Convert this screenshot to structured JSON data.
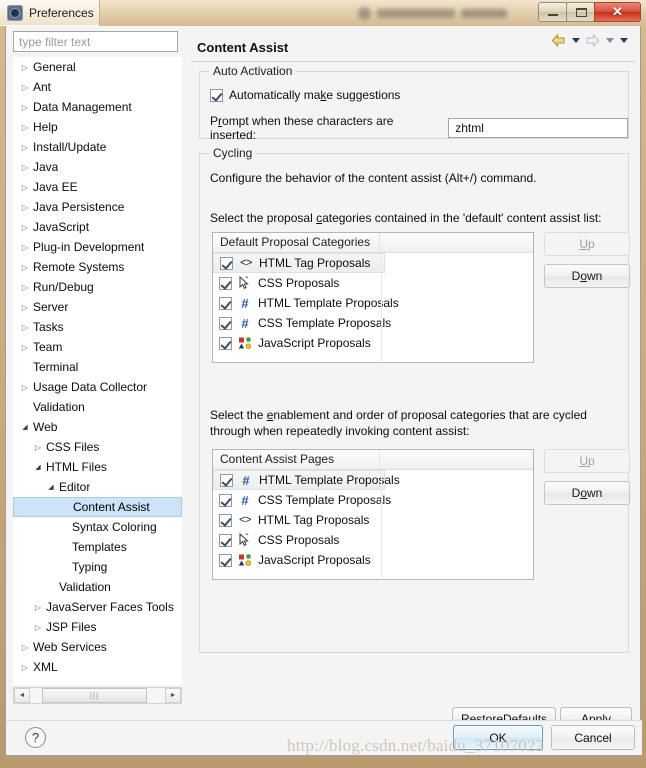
{
  "window": {
    "title": "Preferences",
    "icon": "preferences-gear-icon",
    "minimize_label": "",
    "maximize_label": "",
    "close_label": "✕"
  },
  "sidebar": {
    "filter_placeholder": "type filter text",
    "filter_value": "",
    "items": [
      {
        "label": "General",
        "indent": 0,
        "arrow": "collapsed",
        "selected": false
      },
      {
        "label": "Ant",
        "indent": 0,
        "arrow": "collapsed",
        "selected": false
      },
      {
        "label": "Data Management",
        "indent": 0,
        "arrow": "collapsed",
        "selected": false
      },
      {
        "label": "Help",
        "indent": 0,
        "arrow": "collapsed",
        "selected": false
      },
      {
        "label": "Install/Update",
        "indent": 0,
        "arrow": "collapsed",
        "selected": false
      },
      {
        "label": "Java",
        "indent": 0,
        "arrow": "collapsed",
        "selected": false
      },
      {
        "label": "Java EE",
        "indent": 0,
        "arrow": "collapsed",
        "selected": false
      },
      {
        "label": "Java Persistence",
        "indent": 0,
        "arrow": "collapsed",
        "selected": false
      },
      {
        "label": "JavaScript",
        "indent": 0,
        "arrow": "collapsed",
        "selected": false
      },
      {
        "label": "Plug-in Development",
        "indent": 0,
        "arrow": "collapsed",
        "selected": false
      },
      {
        "label": "Remote Systems",
        "indent": 0,
        "arrow": "collapsed",
        "selected": false
      },
      {
        "label": "Run/Debug",
        "indent": 0,
        "arrow": "collapsed",
        "selected": false
      },
      {
        "label": "Server",
        "indent": 0,
        "arrow": "collapsed",
        "selected": false
      },
      {
        "label": "Tasks",
        "indent": 0,
        "arrow": "collapsed",
        "selected": false
      },
      {
        "label": "Team",
        "indent": 0,
        "arrow": "collapsed",
        "selected": false
      },
      {
        "label": "Terminal",
        "indent": 0,
        "arrow": "none",
        "selected": false
      },
      {
        "label": "Usage Data Collector",
        "indent": 0,
        "arrow": "collapsed",
        "selected": false
      },
      {
        "label": "Validation",
        "indent": 0,
        "arrow": "none",
        "selected": false
      },
      {
        "label": "Web",
        "indent": 0,
        "arrow": "expanded",
        "selected": false
      },
      {
        "label": "CSS Files",
        "indent": 1,
        "arrow": "collapsed",
        "selected": false
      },
      {
        "label": "HTML Files",
        "indent": 1,
        "arrow": "expanded",
        "selected": false
      },
      {
        "label": "Editor",
        "indent": 2,
        "arrow": "expanded",
        "selected": false
      },
      {
        "label": "Content Assist",
        "indent": 3,
        "arrow": "none",
        "selected": true
      },
      {
        "label": "Syntax Coloring",
        "indent": 3,
        "arrow": "none",
        "selected": false
      },
      {
        "label": "Templates",
        "indent": 3,
        "arrow": "none",
        "selected": false
      },
      {
        "label": "Typing",
        "indent": 3,
        "arrow": "none",
        "selected": false
      },
      {
        "label": "Validation",
        "indent": 2,
        "arrow": "none",
        "selected": false
      },
      {
        "label": "JavaServer Faces Tools",
        "indent": 1,
        "arrow": "collapsed",
        "selected": false
      },
      {
        "label": "JSP Files",
        "indent": 1,
        "arrow": "collapsed",
        "selected": false
      },
      {
        "label": "Web Services",
        "indent": 0,
        "arrow": "collapsed",
        "selected": false
      },
      {
        "label": "XML",
        "indent": 0,
        "arrow": "collapsed",
        "selected": false
      }
    ],
    "scrollbar": {
      "left_arrow": "◄",
      "right_arrow": "►",
      "thumb_grip": "|||"
    }
  },
  "page": {
    "title": "Content Assist",
    "nav": {
      "back_icon": "back-arrow-icon",
      "back_caret": "▼",
      "forward_icon": "forward-arrow-icon",
      "forward_caret": "▼",
      "menu_caret": "▼"
    }
  },
  "auto_activation": {
    "group_label": "Auto Activation",
    "checkbox_label_pre": "Automatically ma",
    "checkbox_label_mn": "k",
    "checkbox_label_post": "e suggestions",
    "checkbox_checked": true,
    "prompt_label_pre": "P",
    "prompt_label_mn": "r",
    "prompt_label_post": "ompt when these characters are inserted:",
    "prompt_value": "zhtml"
  },
  "cycling": {
    "group_label": "Cycling",
    "description": "Configure the behavior of the content assist (Alt+/) command.",
    "question1_pre": "Select the proposal ",
    "question1_mn": "c",
    "question1_post": "ategories contained in the 'default' content assist list:",
    "question2_pre": "Select the ",
    "question2_mn": "e",
    "question2_post": "nablement and order of proposal categories that are cycled through when repeatedly invoking content assist:",
    "table1": {
      "column1_header": "Default Proposal Categories",
      "column2_header": "",
      "rows": [
        {
          "checked": true,
          "icon": "html-tag-icon",
          "label": "HTML Tag Proposals",
          "selected": true
        },
        {
          "checked": true,
          "icon": "css-cursor-icon",
          "label": "CSS Proposals",
          "selected": false
        },
        {
          "checked": true,
          "icon": "template-hash-icon",
          "label": "HTML Template Proposals",
          "selected": false
        },
        {
          "checked": true,
          "icon": "template-hash-icon",
          "label": "CSS Template Proposals",
          "selected": false
        },
        {
          "checked": true,
          "icon": "javascript-shapes-icon",
          "label": "JavaScript Proposals",
          "selected": false
        }
      ],
      "up_label": "Up",
      "up_mn": "U",
      "up_enabled": false,
      "down_label": "Down",
      "down_mn": "o",
      "down_enabled": true
    },
    "table2": {
      "column1_header": "Content Assist Pages",
      "column2_header": "",
      "rows": [
        {
          "checked": true,
          "icon": "template-hash-icon",
          "label": "HTML Template Proposals",
          "selected": true
        },
        {
          "checked": true,
          "icon": "template-hash-icon",
          "label": "CSS Template Proposals",
          "selected": false
        },
        {
          "checked": true,
          "icon": "html-tag-icon",
          "label": "HTML Tag Proposals",
          "selected": false
        },
        {
          "checked": true,
          "icon": "css-cursor-icon",
          "label": "CSS Proposals",
          "selected": false
        },
        {
          "checked": true,
          "icon": "javascript-shapes-icon",
          "label": "JavaScript Proposals",
          "selected": false
        }
      ],
      "up_label": "Up",
      "up_mn": "U",
      "up_enabled": false,
      "down_label": "Down",
      "down_mn": "o",
      "down_enabled": true
    }
  },
  "page_buttons": {
    "restore_pre": "Restore ",
    "restore_mn": "D",
    "restore_post": "efaults",
    "apply_pre": "",
    "apply_mn": "A",
    "apply_post": "pply"
  },
  "footer": {
    "help_label": "?",
    "ok_label": "OK",
    "cancel_label": "Cancel"
  },
  "watermark": "http://blog.csdn.net/baidu_37107022",
  "colors": {
    "selection_blue": "#cde3f7",
    "accent_ok_border": "#5a9ad0",
    "title_bar": "#e4d0ae",
    "close_red": "#d7503a"
  }
}
